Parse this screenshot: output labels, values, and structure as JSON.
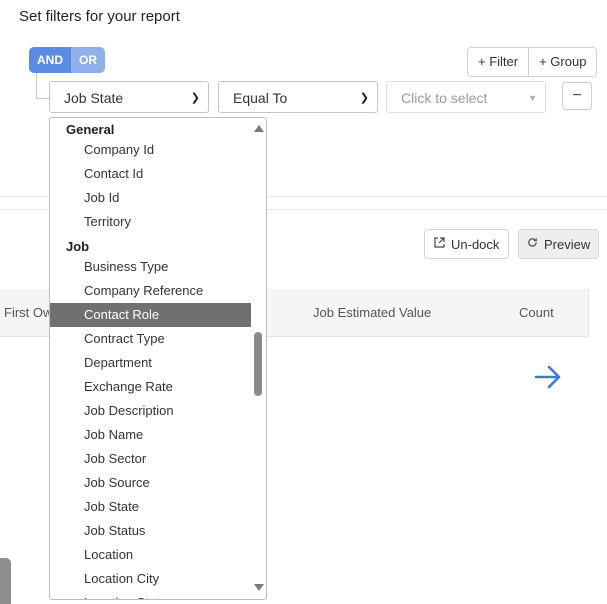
{
  "page": {
    "title": "Set filters for your report"
  },
  "logic": {
    "and_label": "AND",
    "or_label": "OR",
    "active": "AND"
  },
  "toolbar": {
    "filter_label": "+ Filter",
    "group_label": "+ Group"
  },
  "filter_row": {
    "field_value": "Job State",
    "operator_value": "Equal To",
    "value_placeholder": "Click to select",
    "remove_label": "−"
  },
  "actions": {
    "undock_label": "Un-dock",
    "preview_label": "Preview"
  },
  "table": {
    "columns": [
      "First Ow",
      "Job Estimated Value",
      "Count"
    ]
  },
  "dropdown": {
    "groups": [
      {
        "label": "General",
        "items": [
          "Company Id",
          "Contact Id",
          "Job Id",
          "Territory"
        ]
      },
      {
        "label": "Job",
        "items": [
          "Business Type",
          "Company Reference",
          "Contact Role",
          "Contract Type",
          "Department",
          "Exchange Rate",
          "Job Description",
          "Job Name",
          "Job Sector",
          "Job Source",
          "Job State",
          "Job Status",
          "Location",
          "Location City",
          "Location State"
        ]
      }
    ],
    "highlighted": "Contact Role"
  },
  "icons": {
    "chevron": "chevron-down-icon",
    "undock": "external-link-icon",
    "preview": "refresh-icon",
    "next": "arrow-right-icon"
  },
  "colors": {
    "accent": "#5b8ae0",
    "accent_light": "#8fb0eb",
    "arrow": "#3a7bd5",
    "highlight": "#707070"
  }
}
